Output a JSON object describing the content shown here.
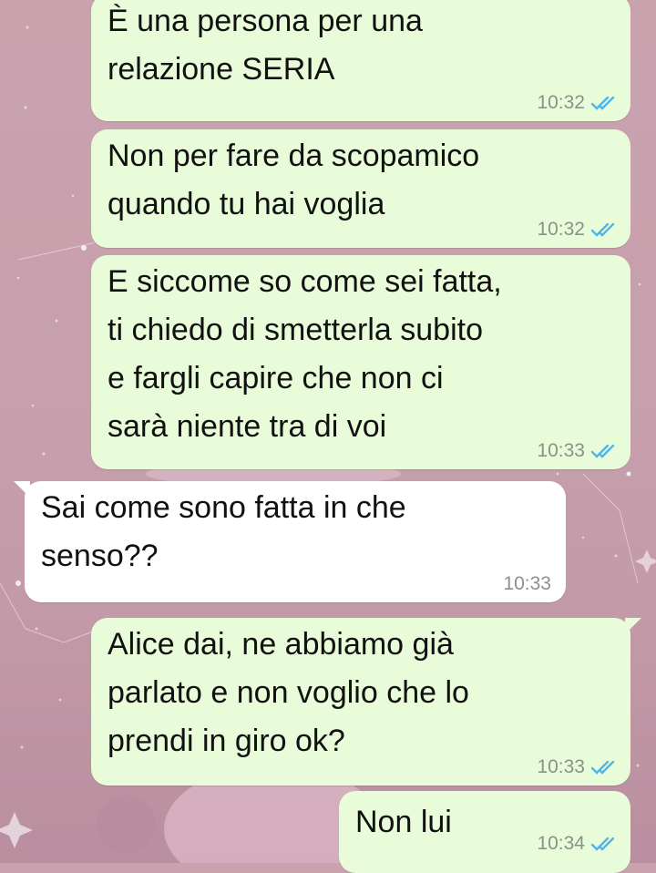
{
  "chat": {
    "messages": [
      {
        "text": "È una persona per una\nrelazione SERIA",
        "time": "10:32",
        "status": "read-double-tick"
      },
      {
        "text": "Non per fare da scopamico\nquando tu hai voglia",
        "time": "10:32",
        "status": "read-double-tick"
      },
      {
        "text": "E siccome so come sei fatta,\nti chiedo di smetterla subito\ne fargli capire che non ci\nsarà niente tra di voi",
        "time": "10:33",
        "status": "read-double-tick"
      },
      {
        "text": "Sai come sono fatta in che\nsenso??",
        "time": "10:33"
      },
      {
        "text": "Alice dai, ne abbiamo già\nparlato e non voglio che lo\nprendi in giro ok?",
        "time": "10:33",
        "status": "read-double-tick"
      },
      {
        "text": "Non lui",
        "time": "10:34",
        "status": "read-double-tick"
      }
    ]
  },
  "colors": {
    "outgoing_bubble": "#e9fcd9",
    "incoming_bubble": "#ffffff",
    "read_tick": "#4fb6ec",
    "time_text": "#8b9189",
    "wallpaper": "#c7a0ad"
  }
}
